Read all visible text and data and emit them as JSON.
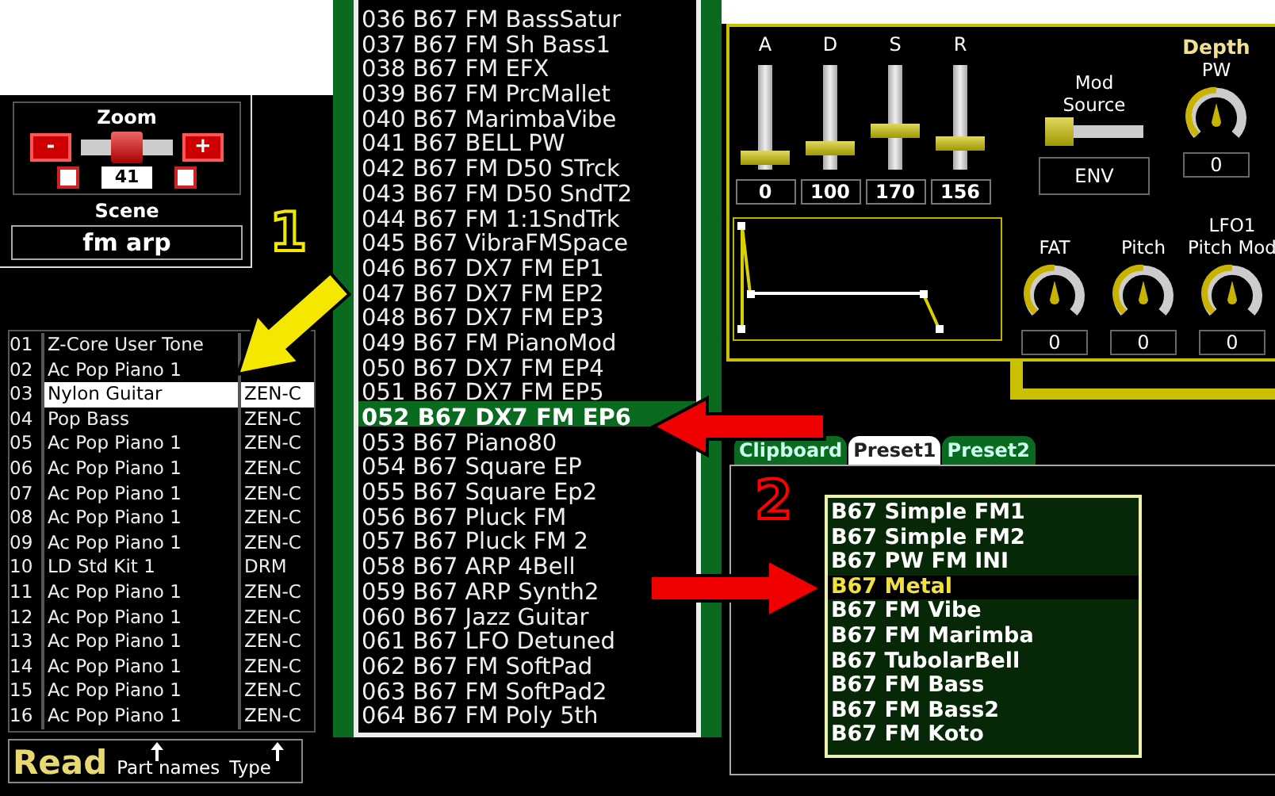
{
  "zoom": {
    "label": "Zoom",
    "minus": "-",
    "plus": "+",
    "level": 0.5,
    "value": "41",
    "checkboxes": [
      {
        "checked": false
      },
      {
        "checked": false
      }
    ]
  },
  "scene": {
    "label": "Scene",
    "value": "fm arp"
  },
  "parts": [
    {
      "number": "01",
      "name": "Z-Core User Tone",
      "selected": false
    },
    {
      "number": "02",
      "name": "Ac Pop Piano 1",
      "selected": false
    },
    {
      "number": "03",
      "name": "Nylon Guitar",
      "type": "ZEN-C",
      "selected": true
    },
    {
      "number": "04",
      "name": "Pop Bass",
      "type": "ZEN-C",
      "selected": false
    },
    {
      "number": "05",
      "name": "Ac Pop Piano 1",
      "type": "ZEN-C",
      "selected": false
    },
    {
      "number": "06",
      "name": "Ac Pop Piano 1",
      "type": "ZEN-C",
      "selected": false
    },
    {
      "number": "07",
      "name": "Ac Pop Piano 1",
      "type": "ZEN-C",
      "selected": false
    },
    {
      "number": "08",
      "name": "Ac Pop Piano 1",
      "type": "ZEN-C",
      "selected": false
    },
    {
      "number": "09",
      "name": "Ac Pop Piano 1",
      "type": "ZEN-C",
      "selected": false
    },
    {
      "number": "10",
      "name": "LD Std Kit 1",
      "type": "DRM",
      "selected": false
    },
    {
      "number": "11",
      "name": "Ac Pop Piano 1",
      "type": "ZEN-C",
      "selected": false
    },
    {
      "number": "12",
      "name": "Ac Pop Piano 1",
      "type": "ZEN-C",
      "selected": false
    },
    {
      "number": "13",
      "name": "Ac Pop Piano 1",
      "type": "ZEN-C",
      "selected": false
    },
    {
      "number": "14",
      "name": "Ac Pop Piano 1",
      "type": "ZEN-C",
      "selected": false
    },
    {
      "number": "15",
      "name": "Ac Pop Piano 1",
      "type": "ZEN-C",
      "selected": false
    },
    {
      "number": "16",
      "name": "Ac Pop Piano 1",
      "type": "ZEN-C",
      "selected": false
    }
  ],
  "read_bar": {
    "read": "Read",
    "part_names": "Part names",
    "type": "Type"
  },
  "presets": [
    {
      "label": "036 B67 FM BassSatur",
      "selected": false
    },
    {
      "label": "037 B67 FM Sh Bass1",
      "selected": false
    },
    {
      "label": "038 B67 FM EFX",
      "selected": false
    },
    {
      "label": "039 B67 FM PrcMallet",
      "selected": false
    },
    {
      "label": "040 B67 MarimbaVibe",
      "selected": false
    },
    {
      "label": "041 B67 BELL PW",
      "selected": false
    },
    {
      "label": "042 B67 FM D50 STrck",
      "selected": false
    },
    {
      "label": "043 B67 FM D50 SndT2",
      "selected": false
    },
    {
      "label": "044 B67 FM 1:1SndTrk",
      "selected": false
    },
    {
      "label": "045 B67 VibraFMSpace",
      "selected": false
    },
    {
      "label": "046 B67 DX7 FM EP1",
      "selected": false
    },
    {
      "label": "047 B67 DX7 FM EP2",
      "selected": false
    },
    {
      "label": "048 B67 DX7 FM EP3",
      "selected": false
    },
    {
      "label": "049 B67 FM PianoMod",
      "selected": false
    },
    {
      "label": "050 B67 DX7 FM EP4",
      "selected": false
    },
    {
      "label": "051 B67 DX7 FM EP5",
      "selected": false
    },
    {
      "label": "052 B67 DX7 FM EP6",
      "selected": true
    },
    {
      "label": "053 B67 Piano80",
      "selected": false
    },
    {
      "label": "054 B67 Square EP",
      "selected": false
    },
    {
      "label": "055 B67 Square Ep2",
      "selected": false
    },
    {
      "label": "056 B67 Pluck FM",
      "selected": false
    },
    {
      "label": "057 B67 Pluck FM 2",
      "selected": false
    },
    {
      "label": "058 B67 ARP 4Bell",
      "selected": false
    },
    {
      "label": "059 B67 ARP Synth2",
      "selected": false
    },
    {
      "label": "060 B67 Jazz Guitar",
      "selected": false
    },
    {
      "label": "061 B67 LFO Detuned",
      "selected": false
    },
    {
      "label": "062 B67 FM SoftPad",
      "selected": false
    },
    {
      "label": "063 B67 FM SoftPad2",
      "selected": false
    },
    {
      "label": "064 B67 FM Poly 5th",
      "selected": false
    }
  ],
  "synth": {
    "sliders": [
      {
        "label": "A",
        "level": 0.06,
        "value": "0"
      },
      {
        "label": "D",
        "level": 0.15,
        "value": "100"
      },
      {
        "label": "S",
        "level": 0.35,
        "value": "170"
      },
      {
        "label": "R",
        "level": 0.2,
        "value": "156"
      }
    ],
    "mod_source": {
      "label_lines": [
        "Mod",
        "Source"
      ],
      "level": 0,
      "value": "ENV"
    },
    "depth_label": "Depth",
    "depth_knob": {
      "label_lines": [
        "PW"
      ],
      "value": "0"
    },
    "knobs": [
      {
        "label_lines": [
          "FAT"
        ],
        "value": "0"
      },
      {
        "label_lines": [
          "Pitch"
        ],
        "value": "0"
      },
      {
        "label_lines": [
          "LFO1",
          "Pitch Mod"
        ],
        "value": "0"
      }
    ]
  },
  "tabs": [
    {
      "label": "Clipboard",
      "selected": false
    },
    {
      "label": "Preset1",
      "selected": true
    },
    {
      "label": "Preset2",
      "selected": false
    }
  ],
  "tones": [
    {
      "label": "B67 Simple FM1",
      "selected": false
    },
    {
      "label": "B67 Simple FM2",
      "selected": false
    },
    {
      "label": "B67 PW FM INI",
      "selected": false
    },
    {
      "label": "B67 Metal",
      "selected": true
    },
    {
      "label": "B67 FM Vibe",
      "selected": false
    },
    {
      "label": "B67 FM Marimba",
      "selected": false
    },
    {
      "label": "B67 TubolarBell",
      "selected": false
    },
    {
      "label": "B67 FM Bass",
      "selected": false
    },
    {
      "label": "B67 FM Bass2",
      "selected": false
    },
    {
      "label": "B67 FM Koto",
      "selected": false
    }
  ],
  "annotations": {
    "step_1": "1",
    "step_2": "2"
  }
}
